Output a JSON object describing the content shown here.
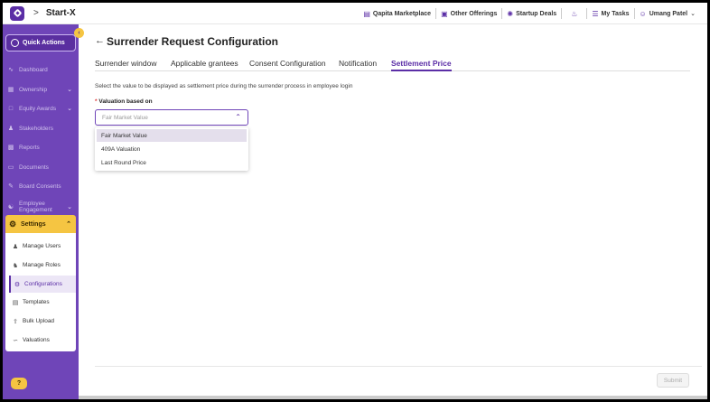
{
  "header": {
    "company": "Start-X",
    "nav": [
      {
        "icon": "chart-icon",
        "label": "Qapita Marketplace"
      },
      {
        "icon": "gift-icon",
        "label": "Other Offerings"
      },
      {
        "icon": "rocket-icon",
        "label": "Startup Deals"
      },
      {
        "icon": "bell-icon",
        "label": ""
      },
      {
        "icon": "clipboard-icon",
        "label": "My Tasks"
      },
      {
        "icon": "user-icon",
        "label": "Umang Patel"
      }
    ]
  },
  "sidebar": {
    "quick_actions": "Quick Actions",
    "items": [
      {
        "label": "Dashboard",
        "has_chevron": false
      },
      {
        "label": "Ownership",
        "has_chevron": true
      },
      {
        "label": "Equity Awards",
        "has_chevron": true
      },
      {
        "label": "Stakeholders",
        "has_chevron": false
      },
      {
        "label": "Reports",
        "has_chevron": false
      },
      {
        "label": "Documents",
        "has_chevron": false
      },
      {
        "label": "Board Consents",
        "has_chevron": false
      },
      {
        "label": "Employee Engagement",
        "has_chevron": true
      }
    ],
    "settings": {
      "label": "Settings",
      "subitems": [
        {
          "label": "Manage Users",
          "active": false
        },
        {
          "label": "Manage Roles",
          "active": false
        },
        {
          "label": "Configurations",
          "active": true
        },
        {
          "label": "Templates",
          "active": false
        },
        {
          "label": "Bulk Upload",
          "active": false
        },
        {
          "label": "Valuations",
          "active": false
        }
      ]
    },
    "help_label": "?"
  },
  "main": {
    "title": "Surrender Request Configuration",
    "tabs": [
      {
        "label": "Surrender window",
        "active": false
      },
      {
        "label": "Applicable grantees",
        "active": false
      },
      {
        "label": "Consent Configuration",
        "active": false
      },
      {
        "label": "Notification",
        "active": false
      },
      {
        "label": "Settlement Price",
        "active": true
      }
    ],
    "description": "Select the value to be displayed as settlement price during the surrender process in employee login",
    "field_label": "Valuation based on",
    "field_required": "*",
    "select_placeholder": "Fair Market Value",
    "options": [
      {
        "label": "Fair Market Value",
        "selected": true
      },
      {
        "label": "409A Valuation",
        "selected": false
      },
      {
        "label": "Last Round Price",
        "selected": false
      }
    ],
    "submit_label": "Submit"
  },
  "colors": {
    "brand": "#6f45b8",
    "accent": "#f5c542",
    "active_tab": "#5b2ea6"
  }
}
